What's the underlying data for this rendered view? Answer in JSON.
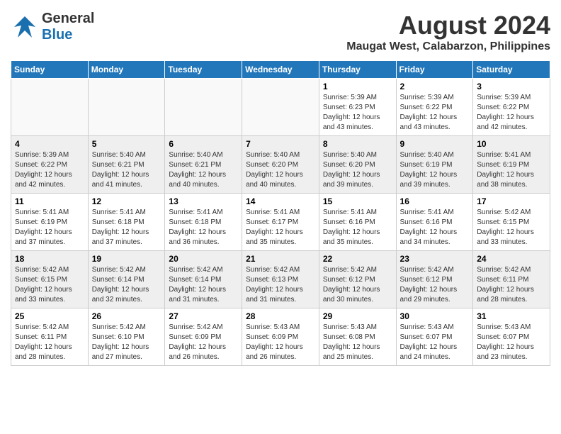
{
  "header": {
    "logo_line1": "General",
    "logo_line2": "Blue",
    "month_year": "August 2024",
    "location": "Maugat West, Calabarzon, Philippines"
  },
  "days_of_week": [
    "Sunday",
    "Monday",
    "Tuesday",
    "Wednesday",
    "Thursday",
    "Friday",
    "Saturday"
  ],
  "weeks": [
    [
      {
        "day": "",
        "info": ""
      },
      {
        "day": "",
        "info": ""
      },
      {
        "day": "",
        "info": ""
      },
      {
        "day": "",
        "info": ""
      },
      {
        "day": "1",
        "info": "Sunrise: 5:39 AM\nSunset: 6:23 PM\nDaylight: 12 hours\nand 43 minutes."
      },
      {
        "day": "2",
        "info": "Sunrise: 5:39 AM\nSunset: 6:22 PM\nDaylight: 12 hours\nand 43 minutes."
      },
      {
        "day": "3",
        "info": "Sunrise: 5:39 AM\nSunset: 6:22 PM\nDaylight: 12 hours\nand 42 minutes."
      }
    ],
    [
      {
        "day": "4",
        "info": "Sunrise: 5:39 AM\nSunset: 6:22 PM\nDaylight: 12 hours\nand 42 minutes."
      },
      {
        "day": "5",
        "info": "Sunrise: 5:40 AM\nSunset: 6:21 PM\nDaylight: 12 hours\nand 41 minutes."
      },
      {
        "day": "6",
        "info": "Sunrise: 5:40 AM\nSunset: 6:21 PM\nDaylight: 12 hours\nand 40 minutes."
      },
      {
        "day": "7",
        "info": "Sunrise: 5:40 AM\nSunset: 6:20 PM\nDaylight: 12 hours\nand 40 minutes."
      },
      {
        "day": "8",
        "info": "Sunrise: 5:40 AM\nSunset: 6:20 PM\nDaylight: 12 hours\nand 39 minutes."
      },
      {
        "day": "9",
        "info": "Sunrise: 5:40 AM\nSunset: 6:19 PM\nDaylight: 12 hours\nand 39 minutes."
      },
      {
        "day": "10",
        "info": "Sunrise: 5:41 AM\nSunset: 6:19 PM\nDaylight: 12 hours\nand 38 minutes."
      }
    ],
    [
      {
        "day": "11",
        "info": "Sunrise: 5:41 AM\nSunset: 6:19 PM\nDaylight: 12 hours\nand 37 minutes."
      },
      {
        "day": "12",
        "info": "Sunrise: 5:41 AM\nSunset: 6:18 PM\nDaylight: 12 hours\nand 37 minutes."
      },
      {
        "day": "13",
        "info": "Sunrise: 5:41 AM\nSunset: 6:18 PM\nDaylight: 12 hours\nand 36 minutes."
      },
      {
        "day": "14",
        "info": "Sunrise: 5:41 AM\nSunset: 6:17 PM\nDaylight: 12 hours\nand 35 minutes."
      },
      {
        "day": "15",
        "info": "Sunrise: 5:41 AM\nSunset: 6:16 PM\nDaylight: 12 hours\nand 35 minutes."
      },
      {
        "day": "16",
        "info": "Sunrise: 5:41 AM\nSunset: 6:16 PM\nDaylight: 12 hours\nand 34 minutes."
      },
      {
        "day": "17",
        "info": "Sunrise: 5:42 AM\nSunset: 6:15 PM\nDaylight: 12 hours\nand 33 minutes."
      }
    ],
    [
      {
        "day": "18",
        "info": "Sunrise: 5:42 AM\nSunset: 6:15 PM\nDaylight: 12 hours\nand 33 minutes."
      },
      {
        "day": "19",
        "info": "Sunrise: 5:42 AM\nSunset: 6:14 PM\nDaylight: 12 hours\nand 32 minutes."
      },
      {
        "day": "20",
        "info": "Sunrise: 5:42 AM\nSunset: 6:14 PM\nDaylight: 12 hours\nand 31 minutes."
      },
      {
        "day": "21",
        "info": "Sunrise: 5:42 AM\nSunset: 6:13 PM\nDaylight: 12 hours\nand 31 minutes."
      },
      {
        "day": "22",
        "info": "Sunrise: 5:42 AM\nSunset: 6:12 PM\nDaylight: 12 hours\nand 30 minutes."
      },
      {
        "day": "23",
        "info": "Sunrise: 5:42 AM\nSunset: 6:12 PM\nDaylight: 12 hours\nand 29 minutes."
      },
      {
        "day": "24",
        "info": "Sunrise: 5:42 AM\nSunset: 6:11 PM\nDaylight: 12 hours\nand 28 minutes."
      }
    ],
    [
      {
        "day": "25",
        "info": "Sunrise: 5:42 AM\nSunset: 6:11 PM\nDaylight: 12 hours\nand 28 minutes."
      },
      {
        "day": "26",
        "info": "Sunrise: 5:42 AM\nSunset: 6:10 PM\nDaylight: 12 hours\nand 27 minutes."
      },
      {
        "day": "27",
        "info": "Sunrise: 5:42 AM\nSunset: 6:09 PM\nDaylight: 12 hours\nand 26 minutes."
      },
      {
        "day": "28",
        "info": "Sunrise: 5:43 AM\nSunset: 6:09 PM\nDaylight: 12 hours\nand 26 minutes."
      },
      {
        "day": "29",
        "info": "Sunrise: 5:43 AM\nSunset: 6:08 PM\nDaylight: 12 hours\nand 25 minutes."
      },
      {
        "day": "30",
        "info": "Sunrise: 5:43 AM\nSunset: 6:07 PM\nDaylight: 12 hours\nand 24 minutes."
      },
      {
        "day": "31",
        "info": "Sunrise: 5:43 AM\nSunset: 6:07 PM\nDaylight: 12 hours\nand 23 minutes."
      }
    ]
  ]
}
